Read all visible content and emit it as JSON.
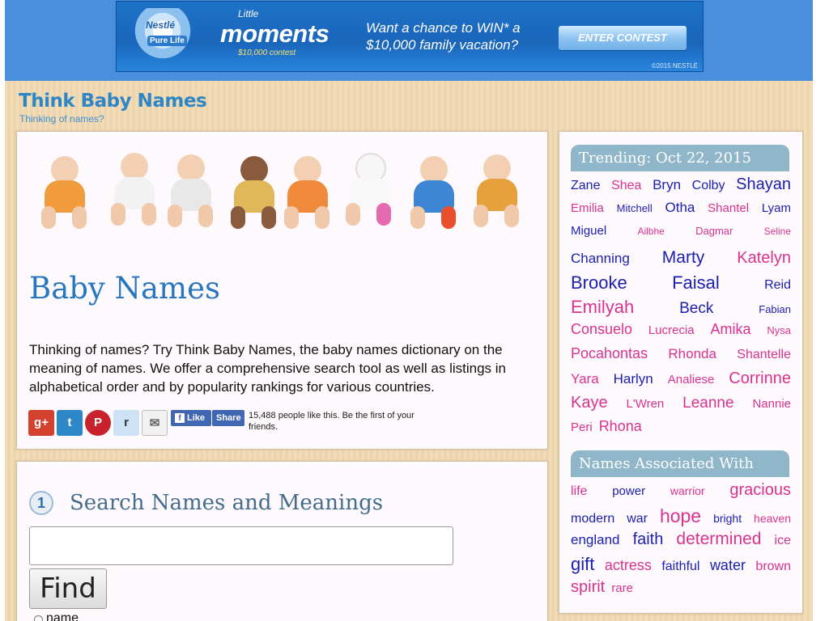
{
  "ad": {
    "brand": "Nestlé",
    "brand_sub": "Pure Life",
    "small": "Little",
    "big": "moments",
    "contest": "$10,000 contest",
    "headline_1": "Want a chance to WIN* a",
    "headline_2": "$10,000 family vacation?",
    "cta": "ENTER CONTEST",
    "copyright": "©2015 NESTLÉ"
  },
  "site": {
    "title": "Think Baby Names",
    "tagline": "Thinking of names?"
  },
  "intro": {
    "title": "Baby Names",
    "text": "Thinking of names? Try Think Baby Names, the baby names dictionary on the meaning of names. We offer a comprehensive search tool as well as listings in alphabetical order and by popularity rankings for various countries.",
    "social": {
      "gplus": "g+",
      "twitter": "t",
      "pinterest": "P",
      "reddit": "r",
      "email": "✉",
      "like_f": "f",
      "like": "Like",
      "share": "Share",
      "count_text": "15,488 people like this. Be the first of your friends."
    }
  },
  "search": {
    "step": "1",
    "heading": "Search Names and Meanings",
    "input_value": "",
    "find_label": "Find",
    "radio_label": "name"
  },
  "trending": {
    "header": "Trending: Oct 22, 2015",
    "rows": [
      [
        {
          "t": "Zane",
          "c": "b",
          "s": 16
        },
        {
          "t": "Shea",
          "c": "p",
          "s": 16
        },
        {
          "t": "Bryn",
          "c": "b",
          "s": 17
        },
        {
          "t": "Colby",
          "c": "b",
          "s": 16
        },
        {
          "t": "Shayan",
          "c": "b",
          "s": 20
        }
      ],
      [
        {
          "t": "Emilia",
          "c": "p",
          "s": 15
        },
        {
          "t": "Mitchell",
          "c": "b",
          "s": 13
        },
        {
          "t": "Otha",
          "c": "b",
          "s": 17
        },
        {
          "t": "Shantel",
          "c": "p",
          "s": 15
        },
        {
          "t": "Lyam",
          "c": "b",
          "s": 15
        }
      ],
      [
        {
          "t": "Miguel",
          "c": "b",
          "s": 15
        },
        {
          "t": "Ailbhe",
          "c": "p",
          "s": 12
        },
        {
          "t": "Dagmar",
          "c": "p",
          "s": 13
        },
        {
          "t": "Seline",
          "c": "p",
          "s": 12
        }
      ],
      [
        {
          "t": "Channing",
          "c": "b",
          "s": 17
        },
        {
          "t": "Marty",
          "c": "b",
          "s": 21
        },
        {
          "t": "Katelyn",
          "c": "p",
          "s": 20
        }
      ],
      [
        {
          "t": "Brooke",
          "c": "b",
          "s": 22
        },
        {
          "t": "Faisal",
          "c": "b",
          "s": 22
        },
        {
          "t": "Reid",
          "c": "b",
          "s": 16
        }
      ],
      [
        {
          "t": "Emilyah",
          "c": "p",
          "s": 22
        },
        {
          "t": "Beck",
          "c": "b",
          "s": 19
        },
        {
          "t": "Fabian",
          "c": "b",
          "s": 13
        }
      ],
      [
        {
          "t": "Consuelo",
          "c": "p",
          "s": 18
        },
        {
          "t": "Lucrecia",
          "c": "p",
          "s": 15
        },
        {
          "t": "Amika",
          "c": "p",
          "s": 18
        },
        {
          "t": "Nysa",
          "c": "p",
          "s": 13
        }
      ],
      [
        {
          "t": "Pocahontas",
          "c": "p",
          "s": 18
        },
        {
          "t": "Rhonda",
          "c": "p",
          "s": 17
        },
        {
          "t": "Shantelle",
          "c": "p",
          "s": 16
        }
      ],
      [
        {
          "t": "Yara",
          "c": "p",
          "s": 17
        },
        {
          "t": "Harlyn",
          "c": "b",
          "s": 17
        },
        {
          "t": "Analiese",
          "c": "p",
          "s": 15
        },
        {
          "t": "Corrinne",
          "c": "p",
          "s": 20
        }
      ],
      [
        {
          "t": "Kaye",
          "c": "p",
          "s": 20
        },
        {
          "t": "L'Wren",
          "c": "p",
          "s": 15
        },
        {
          "t": "Leanne",
          "c": "p",
          "s": 19
        },
        {
          "t": "Nannie",
          "c": "p",
          "s": 15
        }
      ],
      [
        {
          "t": "Peri",
          "c": "p",
          "s": 15
        },
        {
          "t": "Rhona",
          "c": "p",
          "s": 18
        }
      ]
    ]
  },
  "associated": {
    "header": "Names Associated With",
    "rows": [
      [
        {
          "t": "life",
          "c": "p",
          "s": 16
        },
        {
          "t": "power",
          "c": "b",
          "s": 15
        },
        {
          "t": "warrior",
          "c": "p",
          "s": 14
        },
        {
          "t": "gracious",
          "c": "p",
          "s": 20
        }
      ],
      [
        {
          "t": "modern",
          "c": "b",
          "s": 16
        },
        {
          "t": "war",
          "c": "b",
          "s": 16
        },
        {
          "t": "hope",
          "c": "p",
          "s": 23
        },
        {
          "t": "bright",
          "c": "b",
          "s": 14
        },
        {
          "t": "heaven",
          "c": "p",
          "s": 14
        }
      ],
      [
        {
          "t": "england",
          "c": "b",
          "s": 17
        },
        {
          "t": "faith",
          "c": "b",
          "s": 20
        },
        {
          "t": "determined",
          "c": "p",
          "s": 21
        },
        {
          "t": "ice",
          "c": "p",
          "s": 16
        }
      ],
      [
        {
          "t": "gift",
          "c": "b",
          "s": 22
        },
        {
          "t": "actress",
          "c": "p",
          "s": 18
        },
        {
          "t": "faithful",
          "c": "b",
          "s": 16
        },
        {
          "t": "water",
          "c": "b",
          "s": 18
        },
        {
          "t": "brown",
          "c": "p",
          "s": 16
        }
      ],
      [
        {
          "t": "spirit",
          "c": "p",
          "s": 20
        },
        {
          "t": "rare",
          "c": "p",
          "s": 15
        }
      ]
    ]
  },
  "colors": {
    "link_blue": "#1a1fb0",
    "link_pink": "#d8338f",
    "brand_blue": "#2e86c4",
    "section_header": "#8fb6c9"
  }
}
